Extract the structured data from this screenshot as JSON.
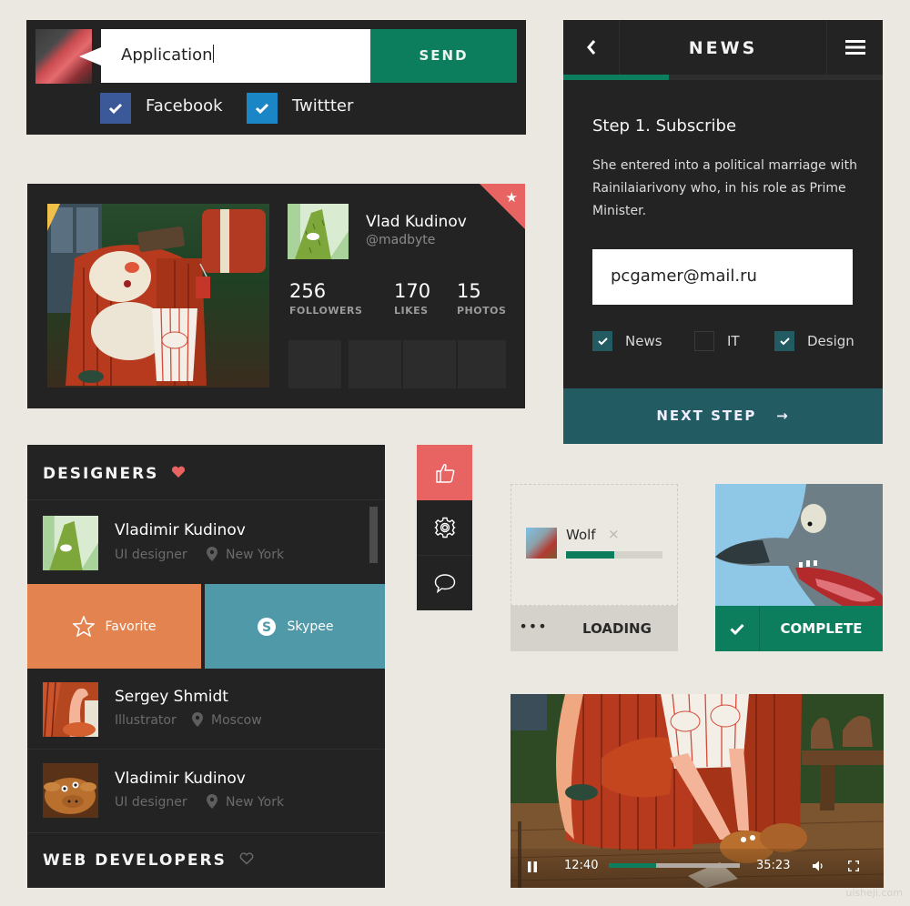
{
  "compose": {
    "input_value": "Application",
    "send_label": "SEND",
    "options": [
      {
        "label": "Facebook",
        "checked": true,
        "color": "#3b5999"
      },
      {
        "label": "Twittter",
        "checked": true,
        "color": "#1a86c5"
      }
    ]
  },
  "profile": {
    "name": "Vlad Kudinov",
    "handle": "@madbyte",
    "stats": [
      {
        "value": "256",
        "label": "FOLLOWERS"
      },
      {
        "value": "170",
        "label": "LIKES"
      },
      {
        "value": "15",
        "label": "PHOTOS"
      }
    ],
    "starred": true
  },
  "news": {
    "title": "NEWS",
    "progress": 0.33,
    "step_title": "Step 1. Subscribe",
    "description": "She entered into a political marriage with Rainilaiarivony who, in his role as Prime Minister.",
    "email_value": "pcgamer@mail.ru",
    "categories": [
      {
        "label": "News",
        "checked": true
      },
      {
        "label": "IT",
        "checked": false
      },
      {
        "label": "Design",
        "checked": true
      }
    ],
    "next_label": "NEXT STEP",
    "next_arrow": "→"
  },
  "designers": {
    "section_title": "DESIGNERS",
    "people": [
      {
        "name": "Vladimir Kudinov",
        "role": "UI designer",
        "location": "New York"
      },
      {
        "name": "Sergey Shmidt",
        "role": "Illustrator",
        "location": "Moscow"
      },
      {
        "name": "Vladimir Kudinov",
        "role": "UI designer",
        "location": "New York"
      }
    ],
    "favorite_label": "Favorite",
    "skype_label": "Skypee",
    "next_section_title": "WEB DEVELOPERS"
  },
  "upload": {
    "file_name": "Wolf",
    "close_glyph": "×",
    "progress": 0.5,
    "more_glyph": "•••",
    "status_label": "LOADING"
  },
  "complete": {
    "label": "COMPLETE"
  },
  "video": {
    "current_time": "12:40",
    "total_time": "35:23",
    "progress": 0.36
  },
  "watermark": "uisheji.com",
  "colors": {
    "green": "#0c7e5e",
    "teal": "#235b62",
    "coral": "#e86462",
    "orange": "#e3834f",
    "skype_blue": "#4f99a8",
    "dark": "#232323"
  }
}
